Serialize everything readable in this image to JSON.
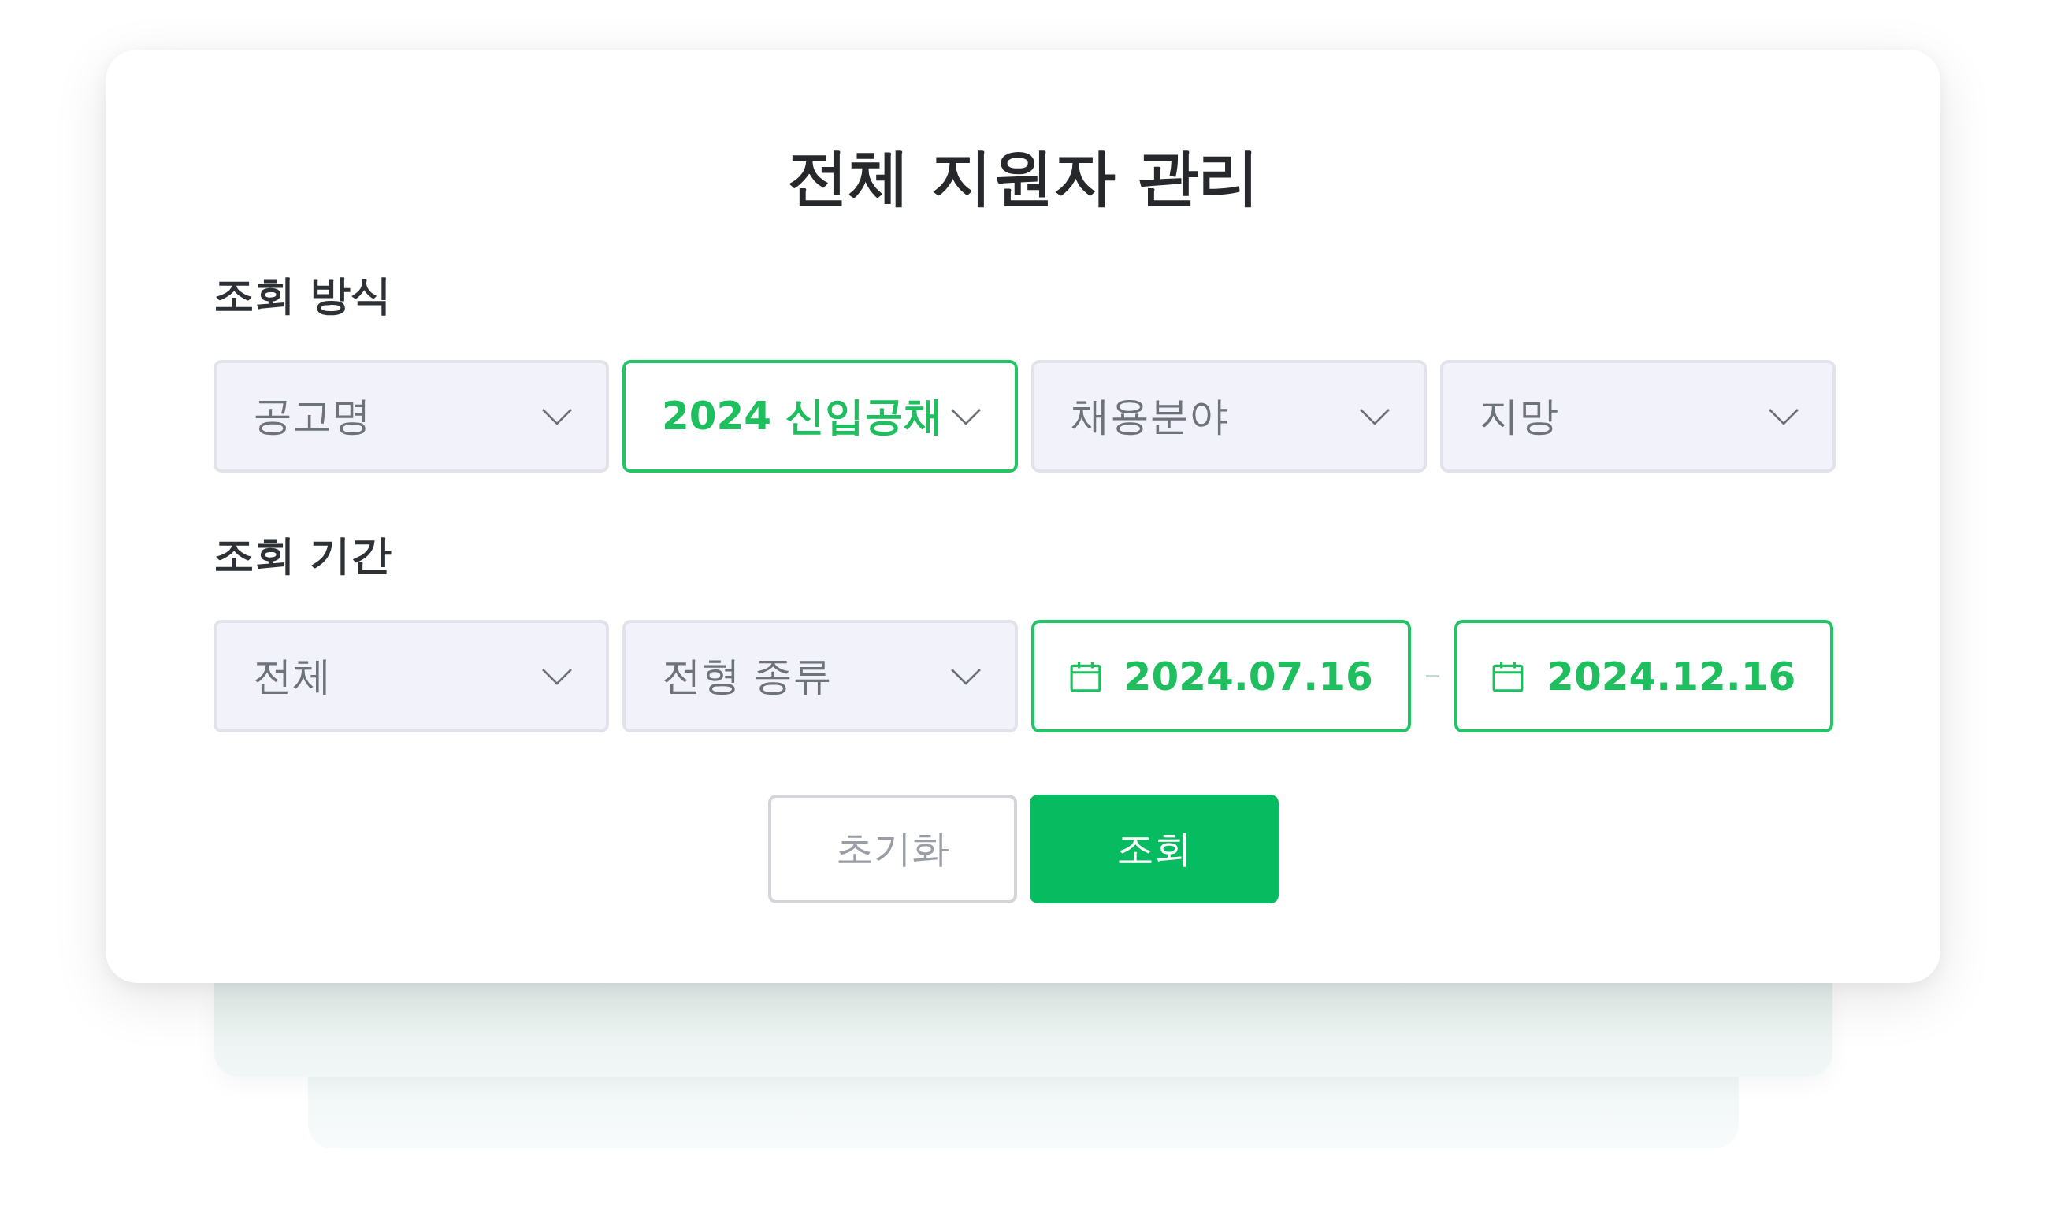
{
  "title": "전체 지원자 관리",
  "sections": [
    {
      "label": "조회 방식",
      "fields": [
        {
          "kind": "select",
          "value": "공고명",
          "selected": false
        },
        {
          "kind": "select",
          "value": "2024 신입공채",
          "selected": true
        },
        {
          "kind": "select",
          "value": "채용분야",
          "selected": false
        },
        {
          "kind": "select",
          "value": "지망",
          "selected": false
        }
      ]
    },
    {
      "label": "조회 기간",
      "fields": [
        {
          "kind": "select",
          "value": "전체",
          "selected": false
        },
        {
          "kind": "select",
          "value": "전형 종류",
          "selected": false
        },
        {
          "kind": "date",
          "value": "2024.07.16",
          "selected": true
        },
        {
          "kind": "date",
          "value": "2024.12.16",
          "selected": true
        }
      ]
    }
  ],
  "buttons": [
    {
      "kind": "secondary",
      "label": "초기화"
    },
    {
      "kind": "primary",
      "label": "조회"
    }
  ]
}
